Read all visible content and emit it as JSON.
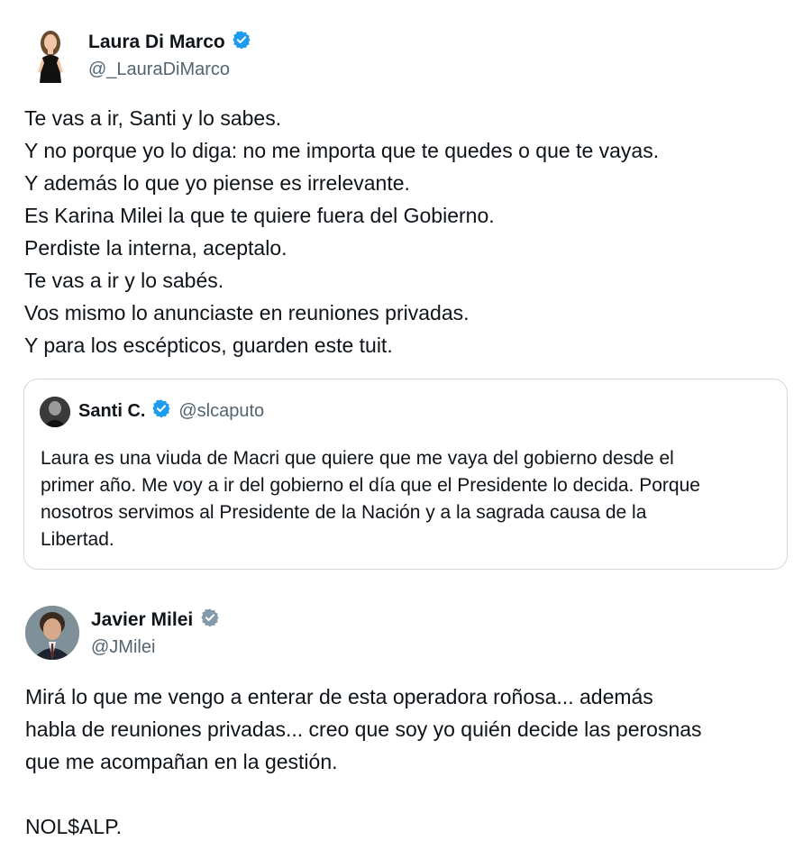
{
  "tweet1": {
    "author_name": "Laura Di Marco",
    "author_handle": "@_LauraDiMarco",
    "verified_badge_color": "#1d9bf0",
    "lines": [
      "Te vas a ir, Santi y lo sabes.",
      "Y no porque yo lo diga: no me importa que te quedes o que te vayas.",
      "Y además lo que yo piense es irrelevante.",
      "Es Karina Milei la que te quiere fuera del Gobierno.",
      "Perdiste la interna, aceptalo.",
      "Te vas a ir y lo sabés.",
      "Vos mismo lo anunciaste en reuniones privadas.",
      "Y para los escépticos, guarden este tuit."
    ]
  },
  "quoted": {
    "author_name": "Santi C.",
    "author_handle": "@slcaputo",
    "verified_badge_color": "#1d9bf0",
    "lines": [
      "Laura es una viuda de Macri que quiere que me vaya del gobierno desde el",
      "primer año. Me voy a ir del gobierno el día que el Presidente lo decida. Porque",
      "nosotros servimos al Presidente de la Nación y a la sagrada causa de la",
      "Libertad."
    ]
  },
  "tweet2": {
    "author_name": "Javier Milei",
    "author_handle": "@JMilei",
    "verified_badge_color": "#829aab",
    "lines": [
      "Mirá lo que me vengo a enterar de esta operadora roñosa... además",
      "habla de reuniones privadas... creo que soy yo quién decide las perosnas",
      "que me acompañan en la gestión.",
      "",
      "NOL$ALP."
    ]
  }
}
